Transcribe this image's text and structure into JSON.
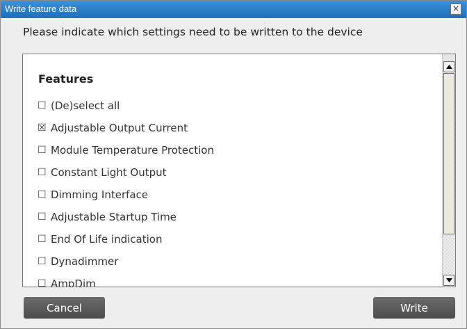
{
  "dialog": {
    "title": "Write feature data",
    "close_glyph": "×"
  },
  "instruction": "Please indicate which settings need to be written to the device",
  "features": {
    "heading": "Features",
    "items": [
      {
        "label": "(De)select all",
        "checked": false,
        "glyph": "☐"
      },
      {
        "label": "Adjustable Output Current",
        "checked": true,
        "glyph": "☒"
      },
      {
        "label": "Module Temperature Protection",
        "checked": false,
        "glyph": "☐"
      },
      {
        "label": "Constant Light Output",
        "checked": false,
        "glyph": "☐"
      },
      {
        "label": "Dimming Interface",
        "checked": false,
        "glyph": "☐"
      },
      {
        "label": "Adjustable Startup Time",
        "checked": false,
        "glyph": "☐"
      },
      {
        "label": "End Of Life indication",
        "checked": false,
        "glyph": "☐"
      },
      {
        "label": "Dynadimmer",
        "checked": false,
        "glyph": "☐"
      },
      {
        "label": "AmpDim",
        "checked": false,
        "glyph": "☐"
      }
    ]
  },
  "scrollbar": {
    "up_icon": "scroll-up-arrow-icon",
    "down_icon": "scroll-down-arrow-icon"
  },
  "buttons": {
    "cancel": "Cancel",
    "write": "Write"
  },
  "colors": {
    "titlebar": "#1d6fbc",
    "button": "#5a5a5a",
    "dialog_bg": "#eeeeee"
  }
}
